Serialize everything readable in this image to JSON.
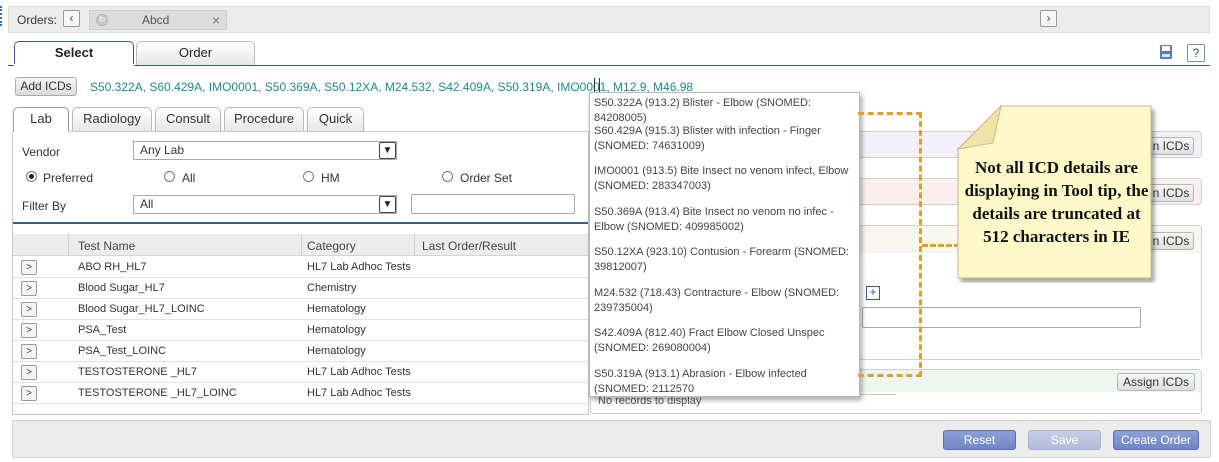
{
  "orders_bar": {
    "label": "Orders:",
    "prev_icon": "chevron-left-icon",
    "next_icon": "chevron-right-icon",
    "tab_name": "Abcd",
    "close_glyph": "×"
  },
  "main_tabs": [
    {
      "label": "Select",
      "active": true
    },
    {
      "label": "Order",
      "active": false
    }
  ],
  "toolbar_icons": [
    "print-icon",
    "help-icon"
  ],
  "help_glyph": "?",
  "add_icds": {
    "button_label": "Add ICDs",
    "codes": "S50.322A, S60.429A, IMO0001, S50.369A, S50.12XA, M24.532, S42.409A, S50.319A, IMO0001, M12.9, M46.98"
  },
  "sub_tabs": [
    {
      "label": "Lab",
      "active": true
    },
    {
      "label": "Radiology",
      "active": false
    },
    {
      "label": "Consult",
      "active": false
    },
    {
      "label": "Procedure",
      "active": false
    },
    {
      "label": "Quick",
      "active": false
    }
  ],
  "lab_panel": {
    "vendor_label": "Vendor",
    "vendor_value": "Any Lab",
    "radios": [
      {
        "label": "Preferred",
        "selected": true
      },
      {
        "label": "All",
        "selected": false
      },
      {
        "label": "HM",
        "selected": false
      },
      {
        "label": "Order Set",
        "selected": false
      }
    ],
    "filter_label": "Filter By",
    "filter_value": "All",
    "filter_text": ""
  },
  "grid": {
    "columns": [
      "Test Name",
      "Category",
      "Last Order/Result"
    ],
    "rows": [
      {
        "name": "ABO RH_HL7",
        "category": "HL7 Lab Adhoc Tests",
        "last": ""
      },
      {
        "name": "Blood Sugar_HL7",
        "category": "Chemistry",
        "last": ""
      },
      {
        "name": "Blood Sugar_HL7_LOINC",
        "category": "Hematology",
        "last": ""
      },
      {
        "name": "PSA_Test",
        "category": "Hematology",
        "last": ""
      },
      {
        "name": "PSA_Test_LOINC",
        "category": "Hematology",
        "last": ""
      },
      {
        "name": "TESTOSTERONE _HL7",
        "category": "HL7 Lab Adhoc Tests",
        "last": ""
      },
      {
        "name": "TESTOSTERONE _HL7_LOINC",
        "category": "HL7 Lab Adhoc Tests",
        "last": ""
      }
    ]
  },
  "right_panels": {
    "assign_partial": "n ICDs",
    "assign_full": "Assign ICDs",
    "no_records": "No records to display",
    "plus_glyph": "+"
  },
  "tooltip": {
    "entries": [
      "S50.322A (913.2) Blister - Elbow (SNOMED: 84208005)",
      "S60.429A (915.3) Blister with  infection - Finger (SNOMED: 74631009)",
      "IMO0001 (913.5) Bite Insect no venom infect, Elbow (SNOMED: 283347003)",
      "S50.369A (913.4) Bite Insect no venom no infec - Elbow (SNOMED: 409985002)",
      "S50.12XA (923.10) Contusion - Forearm (SNOMED: 39812007)",
      "M24.532 (718.43) Contracture -  Elbow (SNOMED: 239735004)",
      "S42.409A (812.40) Fract Elbow Closed Unspec (SNOMED: 269080004)",
      "S50.319A (913.1) Abrasion - Elbow infected (SNOMED: 2112570"
    ]
  },
  "note": {
    "text": "Not all ICD details are displaying in Tool tip, the details are truncated at 512 characters in IE"
  },
  "footer": {
    "reset_label": "Reset",
    "save_label": "Save",
    "create_label": "Create Order"
  },
  "colors": {
    "accent": "#2f5f93",
    "icd_text": "#1e8a8a",
    "callout_dash": "#d9a035",
    "note_fill": "#fff8c9",
    "button_blue": "#6f86c6"
  }
}
